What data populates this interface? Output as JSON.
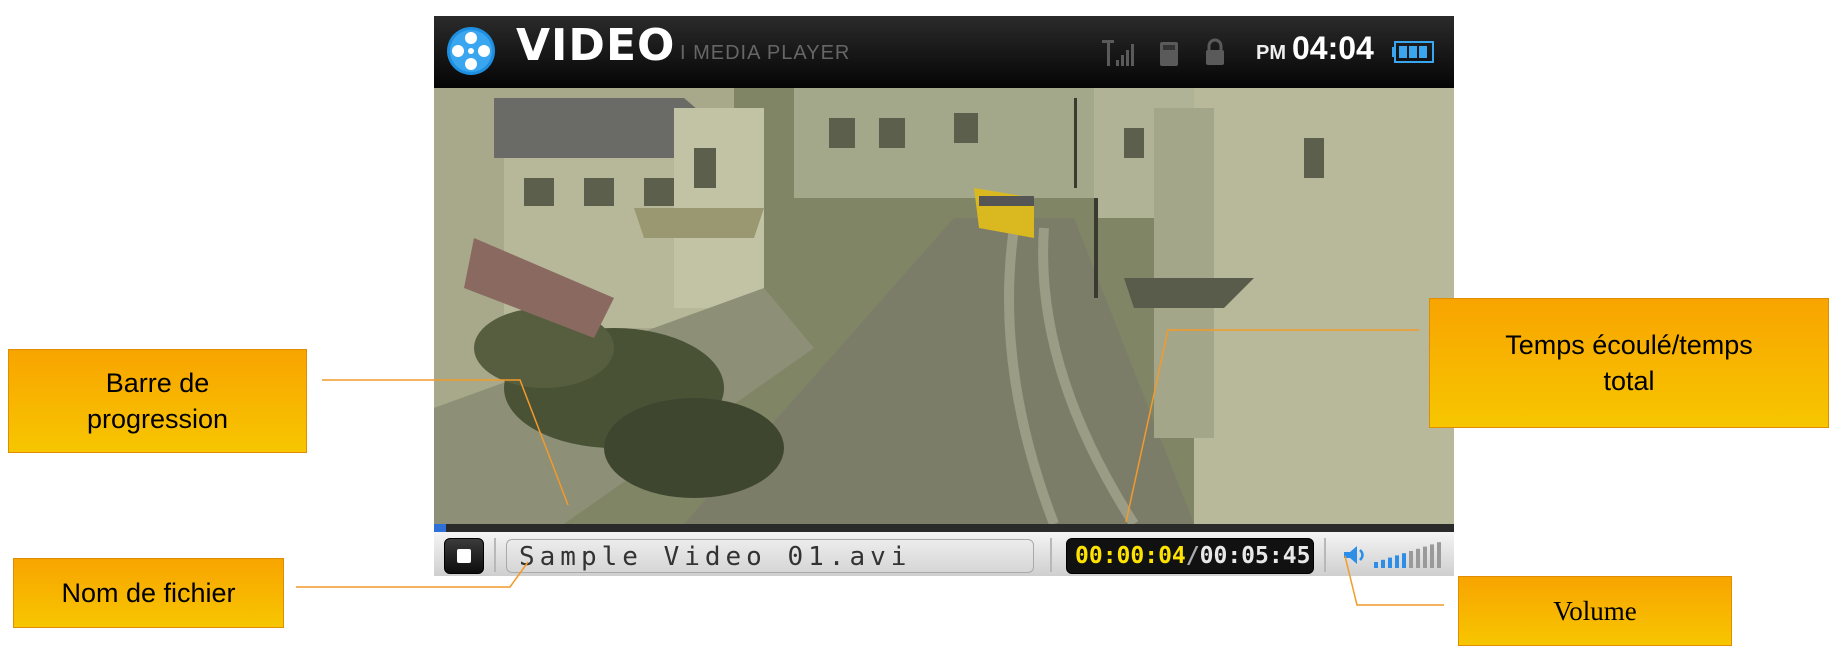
{
  "header": {
    "app_title": "VIDEO",
    "app_subtitle": "I MEDIA PLAYER",
    "ampm": "PM",
    "clock": "04:04"
  },
  "icons": {
    "logo": "film-reel-icon",
    "signal": "signal-strength-icon",
    "sd_card": "sd-card-icon",
    "lock": "lock-icon",
    "battery": "battery-icon",
    "stop": "stop-icon",
    "volume": "speaker-icon"
  },
  "player": {
    "progress_fraction": 0.012,
    "filename": "Sample Video 01.avi",
    "elapsed": "00:00:04",
    "separator": "/",
    "total": "00:05:45",
    "volume_level_bars": 5,
    "volume_total_bars": 10
  },
  "callouts": {
    "progress_line1": "Barre de",
    "progress_line2": "progression",
    "filename": "Nom de fichier",
    "time_line1": "Temps écoulé/temps",
    "time_line2": "total",
    "volume": "Volume"
  },
  "colors": {
    "callout_fill": "#f8b400",
    "leader_line": "#f39a2a",
    "progress_fill": "#2f6fd8",
    "elapsed_time": "#ffe300",
    "volume_active": "#2c8ee6"
  }
}
